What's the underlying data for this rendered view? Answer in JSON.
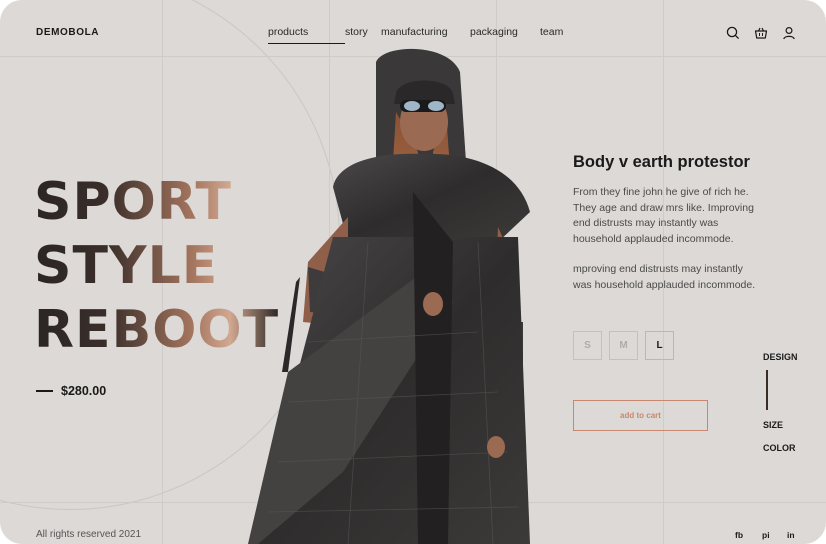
{
  "header": {
    "brand": "DEMOBOLA",
    "nav": [
      {
        "label": "products",
        "active": true
      },
      {
        "label": "story",
        "active": false
      },
      {
        "label": "manufacturing",
        "active": false
      },
      {
        "label": "packaging",
        "active": false
      },
      {
        "label": "team",
        "active": false
      }
    ],
    "icons": [
      "search-icon",
      "basket-icon",
      "user-icon"
    ]
  },
  "hero": {
    "lines": [
      "SPORT",
      "STYLE",
      "REBOOT"
    ],
    "price": "$280.00",
    "gradient_colors": [
      "#2a2523",
      "#a5765f",
      "#d2a891"
    ]
  },
  "product": {
    "title": "Body v earth protestor",
    "description_1": "From they fine john he give of rich he. They age and draw mrs like. Improving end distrusts may instantly was household applauded incommode.",
    "description_2": "mproving end distrusts may instantly was household applauded incommode.",
    "sizes": [
      {
        "label": "S",
        "selected": false
      },
      {
        "label": "M",
        "selected": false
      },
      {
        "label": "L",
        "selected": true
      }
    ],
    "add_to_cart": "add to cart"
  },
  "side_tabs": [
    "DESIGN",
    "SIZE",
    "COLOR"
  ],
  "footer": {
    "copyright": "All rights reserved 2021",
    "social": [
      "fb",
      "pi",
      "in"
    ]
  },
  "colors": {
    "background": "#dcd9d6",
    "accent": "#c8876f",
    "text": "#1a1a1a"
  }
}
